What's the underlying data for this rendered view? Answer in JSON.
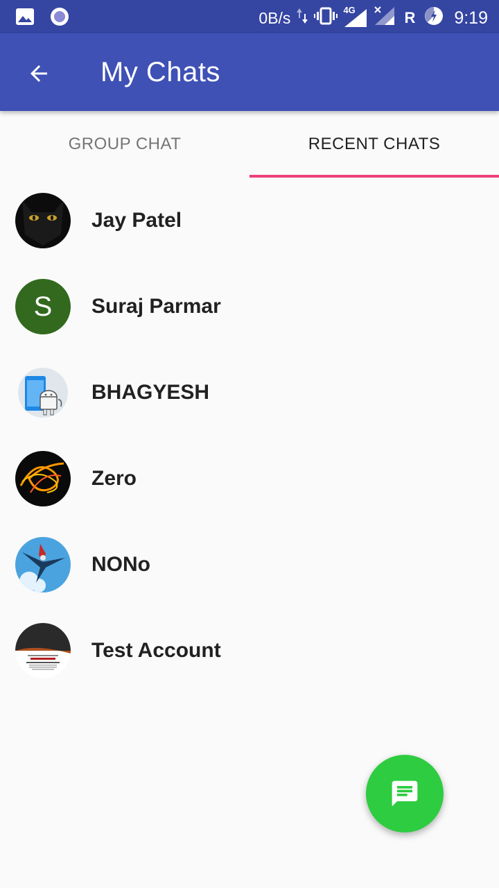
{
  "status_bar": {
    "speed": "0B/s",
    "network": "4G",
    "roaming": "R",
    "time": "9:19",
    "icons": [
      "image-icon",
      "record-icon",
      "data-arrows-icon",
      "vibrate-icon",
      "signal-icon",
      "signal-x-icon",
      "battery-charging-icon"
    ]
  },
  "app_bar": {
    "title": "My Chats",
    "back_icon": "arrow-left-icon",
    "color": "#3f51b5"
  },
  "tabs": [
    {
      "label": "GROUP CHAT",
      "selected": false
    },
    {
      "label": "RECENT CHATS",
      "selected": true
    }
  ],
  "tab_indicator_color": "#ec407a",
  "chats": [
    {
      "name": "Jay Patel",
      "avatar": "black-cat-photo"
    },
    {
      "name": "Suraj Parmar",
      "avatar": "letter",
      "letter": "S",
      "color": "#33691e"
    },
    {
      "name": "BHAGYESH",
      "avatar": "android-phone-icon"
    },
    {
      "name": "Zero",
      "avatar": "orange-light-swirl-photo"
    },
    {
      "name": "NONo",
      "avatar": "anime-character-photo"
    },
    {
      "name": "Test Account",
      "avatar": "the-null-pointer-exception-book-cover"
    }
  ],
  "fab": {
    "icon": "message-icon",
    "color": "#2ecc40"
  }
}
